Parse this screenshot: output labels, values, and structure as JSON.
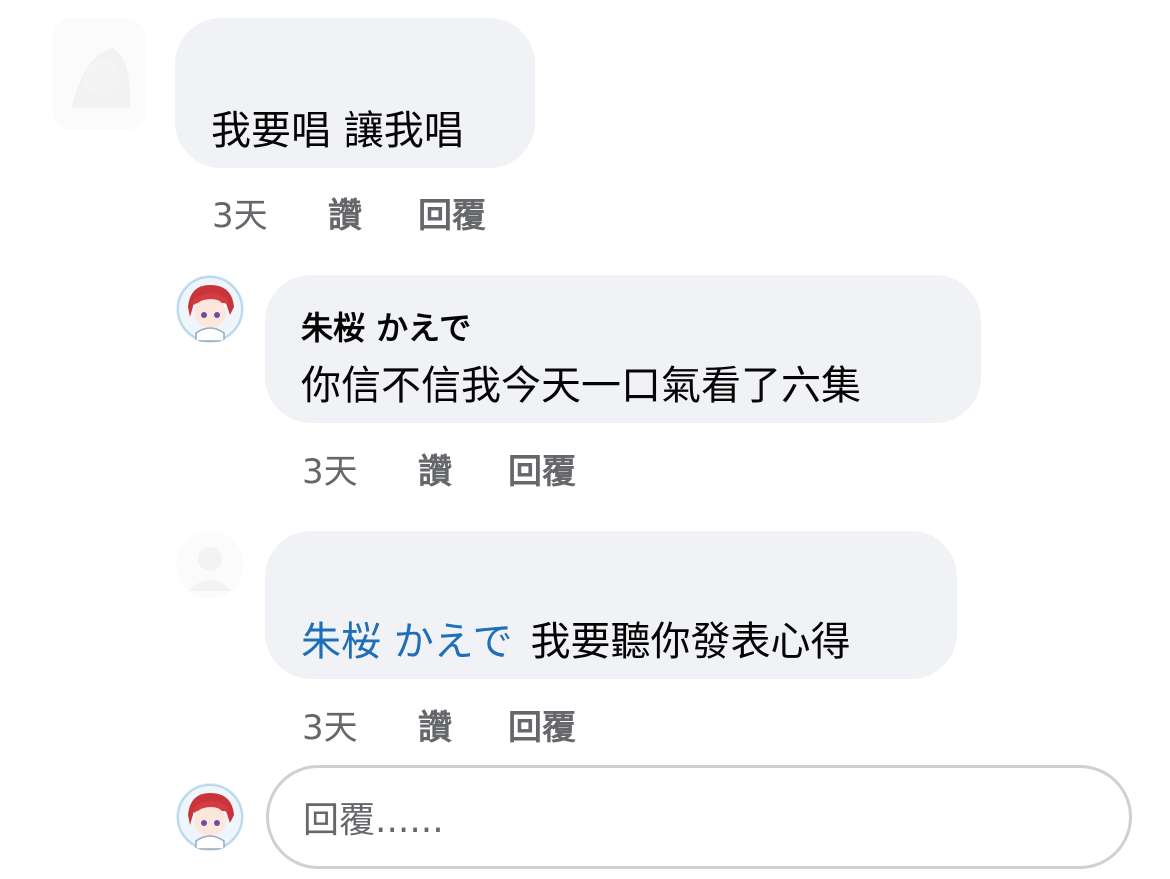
{
  "comments": [
    {
      "author": "",
      "text": "我要唱 讓我唱",
      "mention": "",
      "time": "3天",
      "like_label": "讚",
      "reply_label": "回覆"
    },
    {
      "author": "朱桜 かえで",
      "text": "你信不信我今天一口氣看了六集",
      "mention": "",
      "time": "3天",
      "like_label": "讚",
      "reply_label": "回覆"
    },
    {
      "author": "",
      "text": "我要聽你發表心得",
      "mention": "朱桜 かえで",
      "time": "3天",
      "like_label": "讚",
      "reply_label": "回覆"
    }
  ],
  "reply_box": {
    "placeholder": "回覆......"
  },
  "colors": {
    "bubble": "#f0f2f5",
    "mention": "#1e6fb8",
    "meta": "#65676b"
  }
}
